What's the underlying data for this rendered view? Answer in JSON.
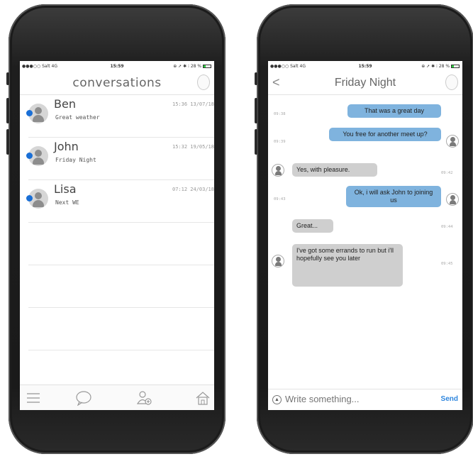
{
  "status_bar": {
    "carrier": "●●●○○ Salt  4G",
    "time": "15:59",
    "icons": "⊕ ➚ ✱ ⁝ 28 %"
  },
  "conversations": {
    "title": "conversations",
    "items": [
      {
        "name": "Ben",
        "preview": "Great weather",
        "timestamp": "15:36 13/07/18"
      },
      {
        "name": "John",
        "preview": "Friday Night",
        "timestamp": "15:32 19/05/18"
      },
      {
        "name": "Lisa",
        "preview": "Next WE",
        "timestamp": "07:12 24/03/18"
      }
    ]
  },
  "chat": {
    "back_glyph": "<",
    "title": "Friday Night",
    "messages": [
      {
        "direction": "out",
        "text": "That was a great day",
        "time": "09:38"
      },
      {
        "direction": "out",
        "text": "You free for another meet up?",
        "time": "09:39"
      },
      {
        "direction": "in",
        "text": "Yes, with pleasure.",
        "time": "09:42"
      },
      {
        "direction": "out",
        "text": "Ok, i will ask John to joining us",
        "time": "09:43"
      },
      {
        "direction": "in",
        "text": "Great...",
        "time": "09:44"
      },
      {
        "direction": "in",
        "text": "I've got some errands to run but i'll hopefully see you later",
        "time": "09:45"
      }
    ],
    "composer": {
      "placeholder": "Write something...",
      "send_label": "Send",
      "icon_glyph": "▲"
    }
  },
  "colors": {
    "outgoing_bubble": "#7fb3de",
    "incoming_bubble": "#cfcfcf",
    "unread_dot": "#1a6fd6",
    "send": "#2e86de"
  },
  "tabbar_icons": [
    "menu-icon",
    "chat-bubble-icon",
    "add-contact-icon",
    "home-icon"
  ]
}
